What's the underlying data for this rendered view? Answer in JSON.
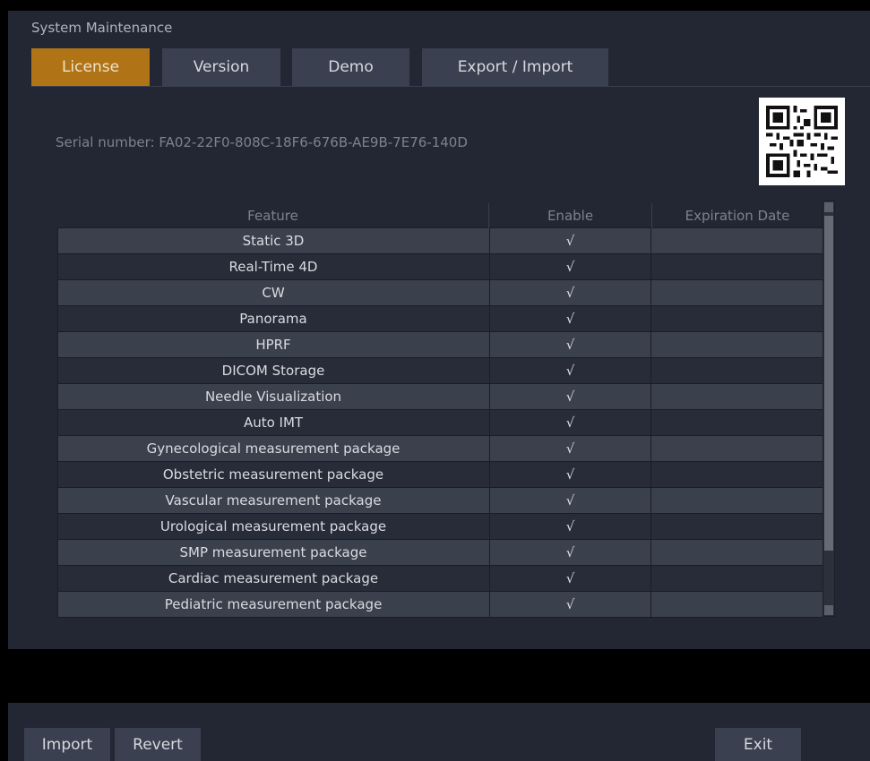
{
  "window_title": "System Maintenance",
  "tabs": [
    {
      "label": "License",
      "active": true
    },
    {
      "label": "Version",
      "active": false
    },
    {
      "label": "Demo",
      "active": false
    },
    {
      "label": "Export / Import",
      "active": false
    }
  ],
  "serial_number": "Serial number: FA02-22F0-808C-18F6-676B-AE9B-7E76-140D",
  "qr_icon": "qr-code",
  "columns": [
    "Feature",
    "Enable",
    "Expiration Date"
  ],
  "features": [
    {
      "feature": "Static 3D",
      "enable": "√",
      "expiration": ""
    },
    {
      "feature": "Real-Time 4D",
      "enable": "√",
      "expiration": ""
    },
    {
      "feature": "CW",
      "enable": "√",
      "expiration": ""
    },
    {
      "feature": "Panorama",
      "enable": "√",
      "expiration": ""
    },
    {
      "feature": "HPRF",
      "enable": "√",
      "expiration": ""
    },
    {
      "feature": "DICOM Storage",
      "enable": "√",
      "expiration": ""
    },
    {
      "feature": "Needle Visualization",
      "enable": "√",
      "expiration": ""
    },
    {
      "feature": "Auto IMT",
      "enable": "√",
      "expiration": ""
    },
    {
      "feature": "Gynecological measurement package",
      "enable": "√",
      "expiration": ""
    },
    {
      "feature": "Obstetric measurement package",
      "enable": "√",
      "expiration": ""
    },
    {
      "feature": "Vascular measurement package",
      "enable": "√",
      "expiration": ""
    },
    {
      "feature": "Urological measurement package",
      "enable": "√",
      "expiration": ""
    },
    {
      "feature": "SMP measurement package",
      "enable": "√",
      "expiration": ""
    },
    {
      "feature": "Cardiac measurement package",
      "enable": "√",
      "expiration": ""
    },
    {
      "feature": "Pediatric measurement package",
      "enable": "√",
      "expiration": ""
    }
  ],
  "buttons": {
    "import": "Import",
    "revert": "Revert",
    "exit": "Exit"
  },
  "colors": {
    "active_tab": "#b07416",
    "panel": "#232733",
    "row_light": "#3b404d",
    "row_dark": "#282c39"
  }
}
